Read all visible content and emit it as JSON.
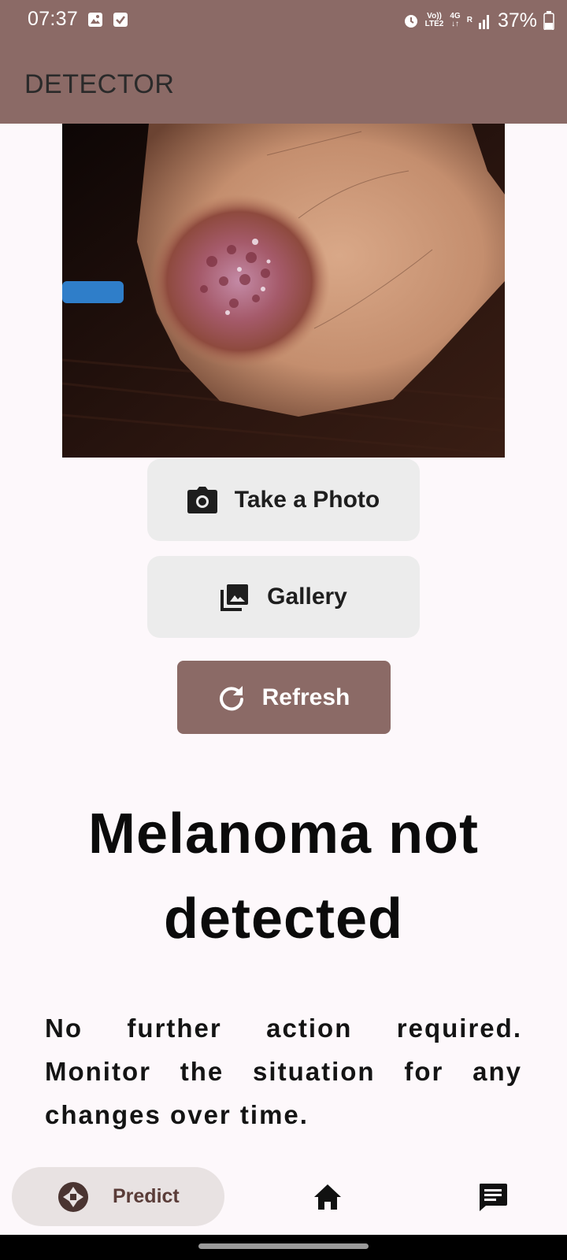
{
  "status_bar": {
    "time": "07:37",
    "network_top": "Vo))",
    "network_bottom": "LTE2",
    "generation": "4G",
    "roaming": "R",
    "battery": "37%",
    "icons": [
      "gallery-icon",
      "checkbox-icon",
      "alarm-icon",
      "signal-icon",
      "battery-icon"
    ]
  },
  "app_bar": {
    "title": "DETECTOR"
  },
  "buttons": {
    "take_photo": {
      "label": "Take a Photo",
      "icon": "camera-icon"
    },
    "gallery": {
      "label": "Gallery",
      "icon": "photo-library-icon"
    },
    "refresh": {
      "label": "Refresh",
      "icon": "refresh-icon"
    }
  },
  "result": {
    "headline": "Melanoma not detected",
    "message": "No further action required. Monitor the situation for any changes over time."
  },
  "bottom_nav": {
    "items": [
      {
        "label": "Predict",
        "icon": "shutter-icon",
        "active": true
      },
      {
        "label": "",
        "icon": "home-icon",
        "active": false
      },
      {
        "label": "",
        "icon": "chat-icon",
        "active": false
      }
    ]
  },
  "colors": {
    "primary": "#8b6a66",
    "background": "#fdf8fb",
    "button_light": "#ececec",
    "nav_pill": "#e8e2e2"
  }
}
